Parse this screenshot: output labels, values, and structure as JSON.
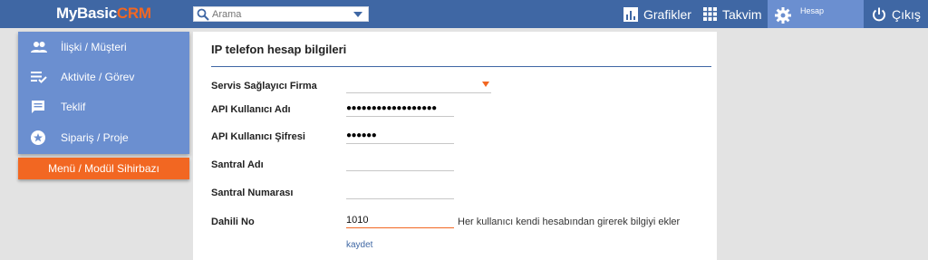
{
  "topbar": {
    "logo_main": "MyBasic",
    "logo_accent": "CRM",
    "search_placeholder": "Arama",
    "nav": {
      "grafikler": "Grafikler",
      "takvim": "Takvim",
      "hesap": "Hesap",
      "cikis": "Çıkış"
    }
  },
  "sidebar": {
    "items": [
      {
        "label": "İlişki / Müşteri",
        "icon": "people-icon"
      },
      {
        "label": "Aktivite / Görev",
        "icon": "task-list-icon"
      },
      {
        "label": "Teklif",
        "icon": "comment-icon"
      },
      {
        "label": "Sipariş / Proje",
        "icon": "star-icon"
      }
    ],
    "wizard_label": "Menü / Modül Sihirbazı"
  },
  "form": {
    "title": "IP telefon hesap bilgileri",
    "fields": {
      "provider": {
        "label": "Servis Sağlayıcı Firma",
        "value": ""
      },
      "api_user": {
        "label": "API Kullanıcı Adı",
        "value": "●●●●●●●●●●●●●●●●●●"
      },
      "api_pass": {
        "label": "API Kullanıcı Şifresi",
        "value": "●●●●●●"
      },
      "pbx_name": {
        "label": "Santral Adı",
        "value": ""
      },
      "pbx_number": {
        "label": "Santral Numarası",
        "value": ""
      },
      "extension": {
        "label": "Dahili No",
        "value": "1010"
      }
    },
    "extension_hint": "Her kullanıcı kendi hesabından girerek bilgiyi ekler",
    "save_label": "kaydet"
  },
  "colors": {
    "topbar": "#3f67a4",
    "menu": "#6b8fd0",
    "accent": "#f26722"
  }
}
